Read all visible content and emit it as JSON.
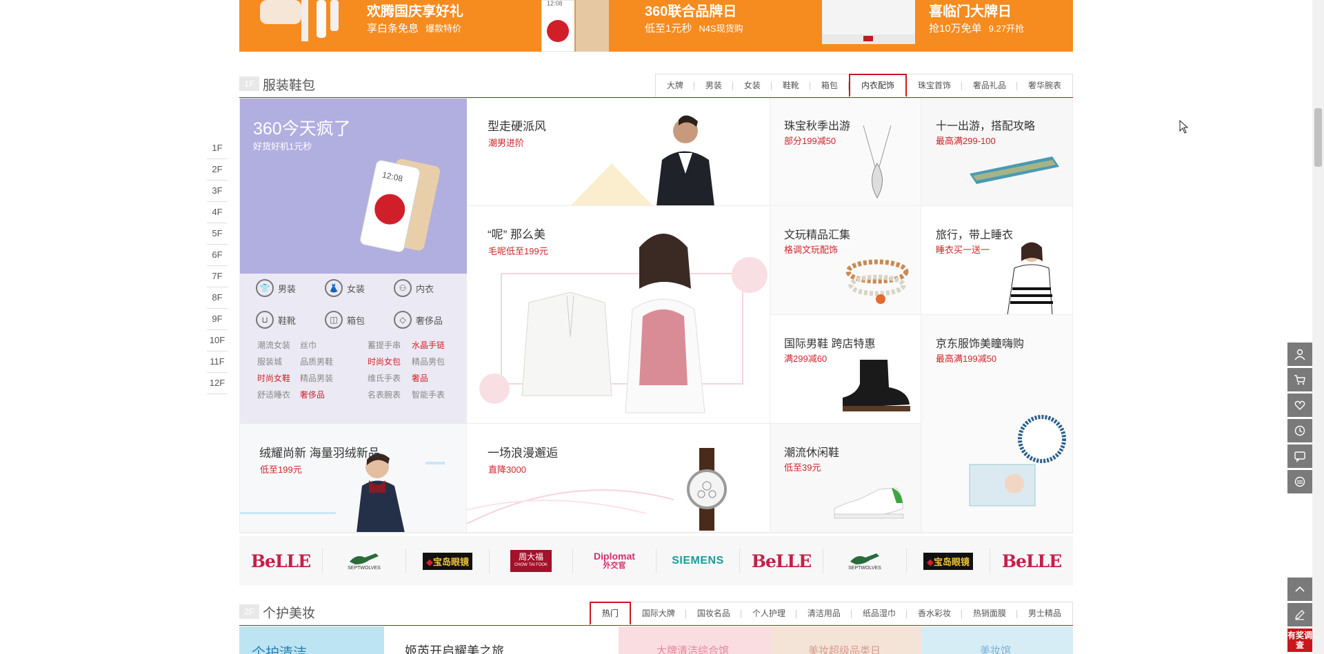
{
  "top_banner": {
    "items": [
      {
        "title": "欢腾国庆享好礼",
        "sub": "享白条免息",
        "sub2": "爆款特价"
      },
      {
        "title": "360联合品牌日",
        "sub": "低至1元秒",
        "sub2": "N4S现货购"
      },
      {
        "title": "喜临门大牌日",
        "sub": "抢10万免单",
        "sub2": "9.27开抢"
      }
    ],
    "color": "#f68b20"
  },
  "floor1": {
    "tag": "1F",
    "title": "服装鞋包",
    "tabs": [
      "大牌",
      "男装",
      "女装",
      "鞋靴",
      "箱包",
      "内衣配饰",
      "珠宝首饰",
      "奢品礼品",
      "奢华腕表"
    ],
    "active_tab": "内衣配饰",
    "left_banner": {
      "title": "360今天疯了",
      "sub": "好货好机1元秒"
    },
    "categories": [
      {
        "label": "男装",
        "icon": "shirt-icon"
      },
      {
        "label": "女装",
        "icon": "dress-icon"
      },
      {
        "label": "内衣",
        "icon": "lingerie-icon"
      },
      {
        "label": "鞋靴",
        "icon": "boot-icon"
      },
      {
        "label": "箱包",
        "icon": "bag-icon"
      },
      {
        "label": "奢侈品",
        "icon": "diamond-icon"
      }
    ],
    "keywords": [
      {
        "text": "潮流女装",
        "hot": false
      },
      {
        "text": "丝巾",
        "hot": false
      },
      {
        "text": "蓄提手串",
        "hot": false
      },
      {
        "text": "水晶手链",
        "hot": true
      },
      {
        "text": "服装城",
        "hot": false
      },
      {
        "text": "品质男鞋",
        "hot": false
      },
      {
        "text": "时尚女包",
        "hot": true
      },
      {
        "text": "精品男包",
        "hot": false
      },
      {
        "text": "时尚女鞋",
        "hot": true
      },
      {
        "text": "精品男装",
        "hot": false
      },
      {
        "text": "维氏手表",
        "hot": false
      },
      {
        "text": "奢品",
        "hot": true
      },
      {
        "text": "舒适睡衣",
        "hot": false
      },
      {
        "text": "奢侈品",
        "hot": true
      },
      {
        "text": "名表腕表",
        "hot": false
      },
      {
        "text": "智能手表",
        "hot": false
      }
    ],
    "cells": {
      "c1": {
        "title": "型走硬派风",
        "sub": "潮男进阶"
      },
      "c2": {
        "title": "珠宝秋季出游",
        "sub": "部分199减50"
      },
      "c3": {
        "title": "十一出游，搭配攻略",
        "sub": "最高满299-100"
      },
      "c4": {
        "title": "“呢” 那么美",
        "sub": "毛呢低至199元"
      },
      "c5": {
        "title": "文玩精品汇集",
        "sub": "格调文玩配饰"
      },
      "c6": {
        "title": "旅行，带上睡衣",
        "sub": "睡衣买一送一"
      },
      "c7": {
        "title": "国际男鞋 跨店特惠",
        "sub": "满299减60"
      },
      "c8": {
        "title": "京东服饰美瞳嗨购",
        "sub": "最高满199减50"
      },
      "c9": {
        "title": "绒耀尚新 海量羽绒新品",
        "sub": "低至199元"
      },
      "c10": {
        "title": "一场浪漫邂逅",
        "sub": "直降3000"
      },
      "c11": {
        "title": "潮流休闲鞋",
        "sub": "低至39元"
      }
    }
  },
  "brands": [
    {
      "type": "belle",
      "name": "BeLLE"
    },
    {
      "type": "sept",
      "name": "SEPTWOLVES"
    },
    {
      "type": "baodao",
      "name": "宝岛眼镜"
    },
    {
      "type": "zhoudafu",
      "name": "周大福",
      "sub": "CHOW TAI FOOK"
    },
    {
      "type": "diplomat",
      "name": "Diplomat",
      "sub": "外交官"
    },
    {
      "type": "siemens",
      "name": "SIEMENS"
    },
    {
      "type": "belle",
      "name": "BeLLE"
    },
    {
      "type": "sept",
      "name": "SEPTWOLVES"
    },
    {
      "type": "baodao",
      "name": "宝岛眼镜"
    },
    {
      "type": "belle",
      "name": "BeLLE"
    }
  ],
  "floor2": {
    "tag": "2F",
    "title": "个护美妆",
    "tabs": [
      "热门",
      "国际大牌",
      "国妆名品",
      "个人护理",
      "清洁用品",
      "纸品湿巾",
      "香水彩妆",
      "热销面膜",
      "男士精品"
    ],
    "active_tab": "热门",
    "banners": [
      "个护清洁",
      "姬芮开启耀美之旅",
      "大牌清洁综合馆",
      "美妆超级品类日",
      "美妆馆"
    ]
  },
  "floor_nav": [
    "1F",
    "2F",
    "3F",
    "4F",
    "5F",
    "6F",
    "7F",
    "8F",
    "9F",
    "10F",
    "11F",
    "12F"
  ],
  "right_toolbar": {
    "icons": [
      "user-icon",
      "cart-icon",
      "heart-icon",
      "history-icon",
      "message-icon",
      "service-icon"
    ],
    "bottom_icons": [
      "back-to-top-icon",
      "feedback-icon"
    ],
    "survey": "有奖调查"
  }
}
